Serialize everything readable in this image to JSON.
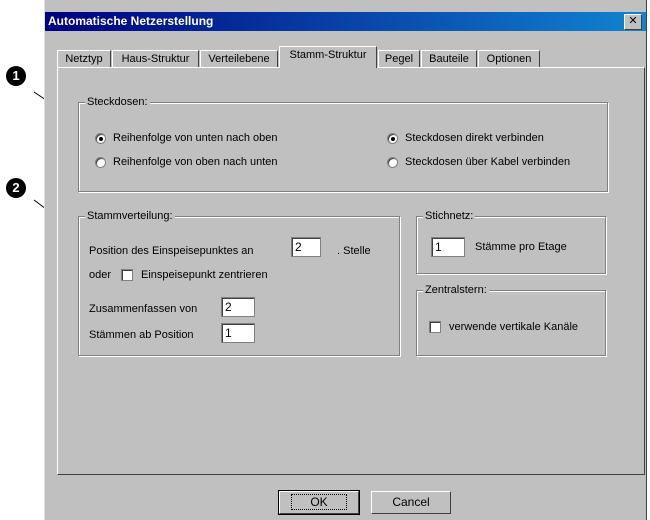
{
  "callouts": {
    "one": "1",
    "two": "2"
  },
  "window": {
    "title": "Automatische Netzerstellung",
    "close_glyph": "✕"
  },
  "tabs": [
    {
      "label": "Netztyp"
    },
    {
      "label": "Haus-Struktur"
    },
    {
      "label": "Verteilebene"
    },
    {
      "label": "Stamm-Struktur",
      "active": true
    },
    {
      "label": "Pegel"
    },
    {
      "label": "Bauteile"
    },
    {
      "label": "Optionen"
    }
  ],
  "steckdosen": {
    "legend": "Steckdosen:",
    "options": [
      {
        "label": "Reihenfolge von unten nach oben",
        "selected": true
      },
      {
        "label": "Reihenfolge von oben nach unten",
        "selected": false
      },
      {
        "label": "Steckdosen direkt verbinden",
        "selected": true
      },
      {
        "label": "Steckdosen über Kabel verbinden",
        "selected": false
      }
    ]
  },
  "stammverteilung": {
    "legend": "Stammverteilung:",
    "position_label": "Position des Einspeisepunktes an",
    "position_value": "2",
    "position_suffix": ". Stelle",
    "oder_label": "oder",
    "zentrieren_label": "Einspeisepunkt zentrieren",
    "zentrieren_checked": false,
    "zusammenfassen_label": "Zusammenfassen von",
    "zusammenfassen_value": "2",
    "ab_position_label": "Stämmen ab Position",
    "ab_position_value": "1"
  },
  "stichnetz": {
    "legend": "Stichnetz:",
    "value": "1",
    "label": "Stämme pro Etage"
  },
  "zentralstern": {
    "legend": "Zentralstern:",
    "checkbox_label": "verwende vertikale Kanäle",
    "checked": false
  },
  "buttons": {
    "ok": "OK",
    "cancel": "Cancel"
  },
  "colors": {
    "face": "#c0c0c0",
    "title_start": "#000080",
    "title_end": "#1084d0"
  }
}
